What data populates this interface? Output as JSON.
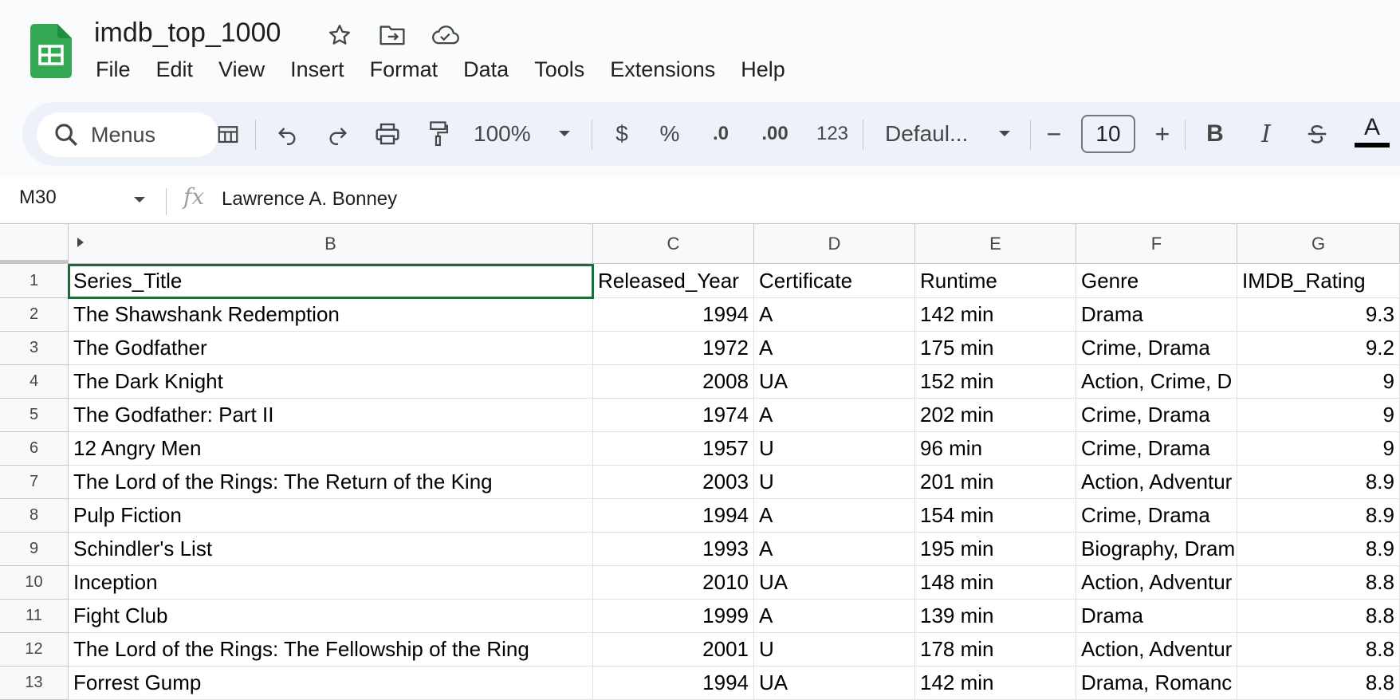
{
  "app": {
    "doc_title": "imdb_top_1000",
    "brand_color": "#34a853",
    "title_icons": [
      "star-icon",
      "move-folder-icon",
      "cloud-saved-icon"
    ]
  },
  "menu": [
    "File",
    "Edit",
    "View",
    "Insert",
    "Format",
    "Data",
    "Tools",
    "Extensions",
    "Help"
  ],
  "toolbar": {
    "search_label": "Menus",
    "zoom": "100%",
    "currency": "$",
    "percent": "%",
    "decrease_decimal": ".0",
    "increase_decimal": ".00",
    "more_formats": "123",
    "font": "Defaul...",
    "font_size": "10",
    "minus": "−",
    "plus": "+",
    "bold": "B",
    "italic": "I",
    "text_color": "A"
  },
  "formula_bar": {
    "name_box": "M30",
    "fx": "fx",
    "content": "Lawrence A. Bonney"
  },
  "columns": [
    "B",
    "C",
    "D",
    "E",
    "F",
    "G"
  ],
  "rows": [
    {
      "n": "1",
      "cells": [
        "Series_Title",
        "Released_Year",
        "Certificate",
        "Runtime",
        "Genre",
        "IMDB_Rating"
      ]
    },
    {
      "n": "2",
      "cells": [
        "The Shawshank Redemption",
        "1994",
        "A",
        "142 min",
        "Drama",
        "9.3"
      ]
    },
    {
      "n": "3",
      "cells": [
        "The Godfather",
        "1972",
        "A",
        "175 min",
        "Crime, Drama",
        "9.2"
      ]
    },
    {
      "n": "4",
      "cells": [
        "The Dark Knight",
        "2008",
        "UA",
        "152 min",
        "Action, Crime, D",
        "9"
      ]
    },
    {
      "n": "5",
      "cells": [
        "The Godfather: Part II",
        "1974",
        "A",
        "202 min",
        "Crime, Drama",
        "9"
      ]
    },
    {
      "n": "6",
      "cells": [
        "12 Angry Men",
        "1957",
        "U",
        "96 min",
        "Crime, Drama",
        "9"
      ]
    },
    {
      "n": "7",
      "cells": [
        "The Lord of the Rings: The Return of the King",
        "2003",
        "U",
        "201 min",
        "Action, Adventur",
        "8.9"
      ]
    },
    {
      "n": "8",
      "cells": [
        "Pulp Fiction",
        "1994",
        "A",
        "154 min",
        "Crime, Drama",
        "8.9"
      ]
    },
    {
      "n": "9",
      "cells": [
        "Schindler's List",
        "1993",
        "A",
        "195 min",
        "Biography, Dram",
        "8.9"
      ]
    },
    {
      "n": "10",
      "cells": [
        "Inception",
        "2010",
        "UA",
        "148 min",
        "Action, Adventur",
        "8.8"
      ]
    },
    {
      "n": "11",
      "cells": [
        "Fight Club",
        "1999",
        "A",
        "139 min",
        "Drama",
        "8.8"
      ]
    },
    {
      "n": "12",
      "cells": [
        "The Lord of the Rings: The Fellowship of the Ring",
        "2001",
        "U",
        "178 min",
        "Action, Adventur",
        "8.8"
      ]
    },
    {
      "n": "13",
      "cells": [
        "Forrest Gump",
        "1994",
        "UA",
        "142 min",
        "Drama, Romanc",
        "8.8"
      ]
    }
  ]
}
